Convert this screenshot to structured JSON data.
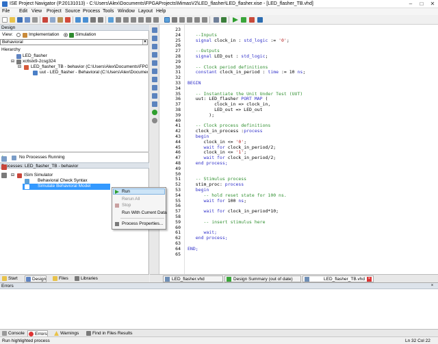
{
  "window": {
    "title": "ISE Project Navigator (P.20131013) - C:\\Users\\Alex\\Documents\\FPGAProjects\\MimasV2\\LED_flasher\\LED_flasher.xise - [LED_flasher_TB.vhd]",
    "minimize": "–",
    "maximize": "□",
    "close": "✕"
  },
  "menu": [
    "File",
    "Edit",
    "View",
    "Project",
    "Source",
    "Process",
    "Tools",
    "Window",
    "Layout",
    "Help"
  ],
  "design_panel": {
    "title": "Design",
    "view_label": "View:",
    "view_implementation": "Implementation",
    "view_simulation": "Simulation",
    "behavioral_select": "Behavioral",
    "hierarchy_label": "Hierarchy",
    "tree": [
      "LED_flasher",
      "xc6slx9-2csg324",
      "LED_flasher_TB - behavior (C:\\Users\\Alex\\Documents\\FPGAPro",
      "uut - LED_flasher - Behavioral (C:\\Users\\Alex\\Documents\\FP"
    ]
  },
  "processes_panel": {
    "running_label": "No Processes Running",
    "header": "Processes: LED_flasher_TB - behavior",
    "items": [
      "ISim Simulator",
      "Behavioral Check Syntax",
      "Simulate Behavioral Model"
    ]
  },
  "context_menu": {
    "items": [
      "Run",
      "Rerun All",
      "Stop",
      "Run With Current Data",
      "Process Properties..."
    ]
  },
  "editor": {
    "lines": [
      {
        "n": "23",
        "t": ""
      },
      {
        "n": "24",
        "t": "   --Inputs",
        "c": "com"
      },
      {
        "n": "25",
        "t": "   signal clock_in : std_logic := '0';",
        "c": "mix1"
      },
      {
        "n": "26",
        "t": ""
      },
      {
        "n": "27",
        "t": "   --Outputs",
        "c": "com"
      },
      {
        "n": "28",
        "t": "   signal LED_out : std_logic;",
        "c": "mix2"
      },
      {
        "n": "29",
        "t": ""
      },
      {
        "n": "30",
        "t": "   -- Clock period definitions",
        "c": "com"
      },
      {
        "n": "31",
        "t": "   constant clock_in_period : time := 10 ns;",
        "c": "mix3"
      },
      {
        "n": "32",
        "t": ""
      },
      {
        "n": "33",
        "t": "BEGIN",
        "c": "kw"
      },
      {
        "n": "34",
        "t": ""
      },
      {
        "n": "35",
        "t": "   -- Instantiate the Unit Under Test (UUT)",
        "c": "com"
      },
      {
        "n": "36",
        "t": "   uut: LED_flasher PORT MAP (",
        "c": "mix4"
      },
      {
        "n": "37",
        "t": "          clock_in => clock_in,"
      },
      {
        "n": "38",
        "t": "          LED_out => LED_out"
      },
      {
        "n": "39",
        "t": "        );"
      },
      {
        "n": "40",
        "t": ""
      },
      {
        "n": "41",
        "t": "   -- Clock process definitions",
        "c": "com"
      },
      {
        "n": "42",
        "t": "   clock_in_process :process",
        "c": "mix5"
      },
      {
        "n": "43",
        "t": "   begin",
        "c": "kw"
      },
      {
        "n": "44",
        "t": "      clock_in <= '0';",
        "c": "mix6"
      },
      {
        "n": "45",
        "t": "      wait for clock_in_period/2;",
        "c": "mix7"
      },
      {
        "n": "46",
        "t": "      clock_in <= '1';",
        "c": "mix6b"
      },
      {
        "n": "47",
        "t": "      wait for clock_in_period/2;",
        "c": "mix7"
      },
      {
        "n": "48",
        "t": "   end process;",
        "c": "kw"
      },
      {
        "n": "49",
        "t": ""
      },
      {
        "n": "50",
        "t": ""
      },
      {
        "n": "51",
        "t": "   -- Stimulus process",
        "c": "com"
      },
      {
        "n": "52",
        "t": "   stim_proc: process",
        "c": "mix8"
      },
      {
        "n": "53",
        "t": "   begin",
        "c": "kw"
      },
      {
        "n": "54",
        "t": "      -- hold reset state for 100 ns.",
        "c": "com"
      },
      {
        "n": "55",
        "t": "      wait for 100 ns;",
        "c": "mix9"
      },
      {
        "n": "56",
        "t": ""
      },
      {
        "n": "57",
        "t": "      wait for clock_in_period*10;",
        "c": "mix10"
      },
      {
        "n": "58",
        "t": ""
      },
      {
        "n": "59",
        "t": "      -- insert stimulus here",
        "c": "com"
      },
      {
        "n": "60",
        "t": ""
      },
      {
        "n": "61",
        "t": "      wait;",
        "c": "kw"
      },
      {
        "n": "62",
        "t": "   end process;",
        "c": "kw"
      },
      {
        "n": "63",
        "t": ""
      },
      {
        "n": "64",
        "t": "END;",
        "c": "kw"
      },
      {
        "n": "65",
        "t": ""
      }
    ]
  },
  "left_tabs": [
    "Start",
    "Design",
    "Files",
    "Libraries"
  ],
  "editor_tabs": [
    "LED_flasher.vhd",
    "Design Summary (out of date)",
    "LED_flasher_TB.vhd"
  ],
  "errors_panel": {
    "title": "Errors"
  },
  "bottom_tabs": [
    "Console",
    "Errors",
    "Warnings",
    "Find in Files Results"
  ],
  "status": {
    "left": "Run highlighted process",
    "right": "Ln 32 Col 22"
  },
  "colors": {
    "selection": "#3399ff",
    "comment": "#2f8f2f",
    "keyword": "#2f2fc9",
    "string": "#b31a1a"
  }
}
